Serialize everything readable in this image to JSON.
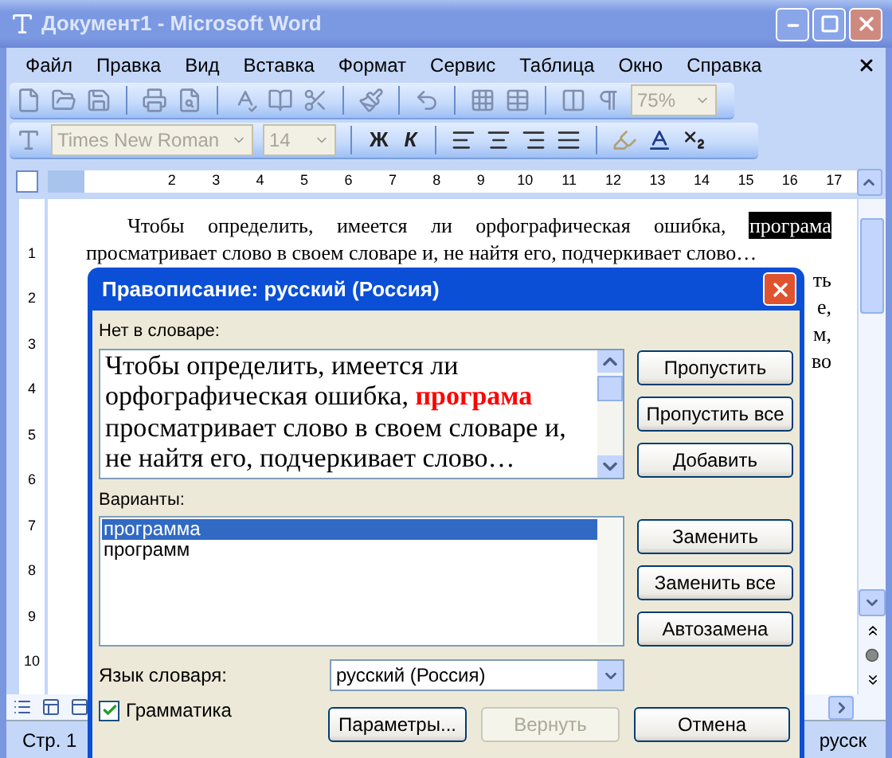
{
  "window": {
    "title": "Документ1 - Microsoft Word"
  },
  "menu": [
    "Файл",
    "Правка",
    "Вид",
    "Вставка",
    "Формат",
    "Сервис",
    "Таблица",
    "Окно",
    "Справка"
  ],
  "toolbar_standard": {
    "zoom": "75%"
  },
  "toolbar_formatting": {
    "font": "Times New Roman",
    "size": "14",
    "bold": "Ж",
    "italic": "К"
  },
  "ruler": {
    "numbers": [
      "2",
      "3",
      "4",
      "5",
      "6",
      "7",
      "8",
      "9",
      "10",
      "11",
      "12",
      "13",
      "14",
      "15",
      "16",
      "17"
    ]
  },
  "vertical_ruler": {
    "numbers": [
      "1",
      "2",
      "3",
      "4",
      "5",
      "6",
      "7",
      "8",
      "9",
      "10"
    ]
  },
  "document": {
    "line_1": {
      "text": "Чтобы определить, имеется ли орфографическая ошибка,",
      "highlighted": "програма"
    },
    "line_2": "просматривает слово в своем словаре и, не найтя его, подчеркивает слово…",
    "fragments": [
      "ть",
      "е,",
      "м,",
      "во"
    ]
  },
  "dialog": {
    "title": "Правописание: русский (Россия)",
    "not_in_dictionary": {
      "label": "Нет в словаре:",
      "before": "Чтобы определить, имеется ли орфографическая ошибка,",
      "error": "програма",
      "after": "просматривает слово в своем словаре и, не найтя его, подчеркивает слово…"
    },
    "buttons_top": [
      {
        "label": "Пропустить",
        "disabled": false
      },
      {
        "label": "Пропустить все",
        "disabled": false
      },
      {
        "label": "Добавить",
        "disabled": false
      }
    ],
    "suggestions": {
      "label": "Варианты:",
      "items": [
        {
          "text": "программа",
          "selected": true
        },
        {
          "text": "программ",
          "selected": false
        }
      ]
    },
    "buttons_middle": [
      {
        "label": "Заменить",
        "disabled": false
      },
      {
        "label": "Заменить все",
        "disabled": false
      },
      {
        "label": "Автозамена",
        "disabled": false
      }
    ],
    "language": {
      "label": "Язык словаря:",
      "value": "русский (Россия)"
    },
    "grammar": {
      "label": "Грамматика",
      "checked": true
    },
    "buttons_bottom": [
      {
        "label": "Параметры...",
        "disabled": false
      },
      {
        "label": "Вернуть",
        "disabled": true
      },
      {
        "label": "Отмена",
        "disabled": false
      }
    ]
  },
  "status_bar": {
    "page": "Стр. 1",
    "language": "русск"
  }
}
